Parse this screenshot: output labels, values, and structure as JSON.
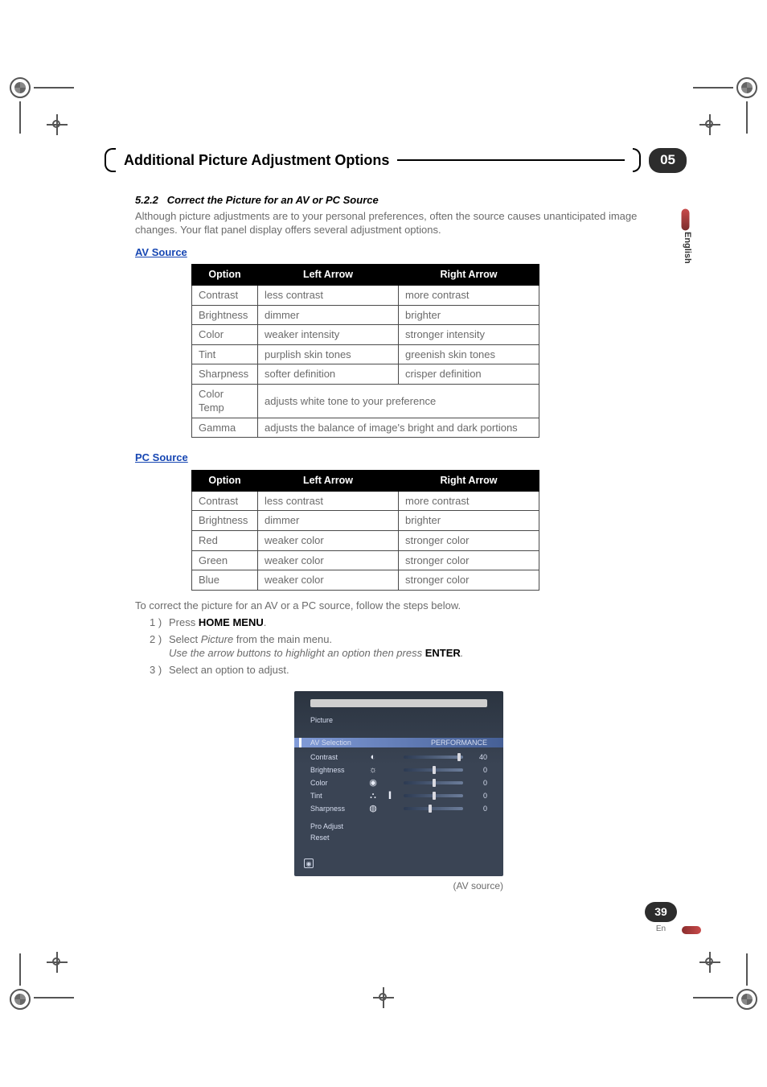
{
  "chapter": {
    "title": "Additional Picture Adjustment Options",
    "number": "05"
  },
  "side": {
    "lang": "English"
  },
  "section": {
    "number": "5.2.2",
    "title": "Correct the Picture for an AV or PC Source",
    "para": "Although picture adjustments are to your personal preferences, often the source causes unanticipated image changes. Your flat panel display offers several adjustment options."
  },
  "tables": {
    "av": {
      "label": "AV Source",
      "headers": {
        "opt": "Option",
        "left": "Left Arrow",
        "right": "Right Arrow"
      },
      "rows": [
        {
          "opt": "Contrast",
          "left": "less contrast",
          "right": "more contrast"
        },
        {
          "opt": "Brightness",
          "left": "dimmer",
          "right": "brighter"
        },
        {
          "opt": "Color",
          "left": "weaker intensity",
          "right": "stronger intensity"
        },
        {
          "opt": "Tint",
          "left": "purplish skin tones",
          "right": "greenish skin tones"
        },
        {
          "opt": "Sharpness",
          "left": "softer definition",
          "right": "crisper definition"
        },
        {
          "opt": "Color Temp",
          "span": "adjusts white tone to your preference"
        },
        {
          "opt": "Gamma",
          "span": "adjusts the balance of image's bright and dark portions"
        }
      ]
    },
    "pc": {
      "label": "PC Source",
      "headers": {
        "opt": "Option",
        "left": "Left Arrow",
        "right": "Right Arrow"
      },
      "rows": [
        {
          "opt": "Contrast",
          "left": "less contrast",
          "right": "more contrast"
        },
        {
          "opt": "Brightness",
          "left": "dimmer",
          "right": "brighter"
        },
        {
          "opt": "Red",
          "left": "weaker color",
          "right": "stronger color"
        },
        {
          "opt": "Green",
          "left": "weaker color",
          "right": "stronger color"
        },
        {
          "opt": "Blue",
          "left": "weaker color",
          "right": "stronger color"
        }
      ]
    }
  },
  "steps": {
    "intro": "To correct the picture for an AV or a PC source, follow the steps below.",
    "items": [
      {
        "pre": "Press ",
        "bold": "HOME MENU",
        "post": "."
      },
      {
        "pre": "Select ",
        "ital": "Picture",
        "mid": " from the main menu.",
        "sub_ital": "Use the arrow buttons to highlight an option then press ",
        "sub_bold": "ENTER",
        "sub_post": "."
      },
      {
        "pre": "Select an option to adjust."
      }
    ]
  },
  "osd": {
    "title": "Picture",
    "highlight": "AV Selection",
    "highlight_val": "PERFORMANCE",
    "rows": [
      {
        "label": "Contrast",
        "icon": "◐",
        "ind": "",
        "val": "40",
        "pos": 90
      },
      {
        "label": "Brightness",
        "icon": "☼",
        "ind": "",
        "val": "0",
        "pos": 48
      },
      {
        "label": "Color",
        "icon": "◉",
        "ind": "",
        "val": "0",
        "pos": 48
      },
      {
        "label": "Tint",
        "icon": "⛬",
        "ind": "▍",
        "val": "0",
        "pos": 48
      },
      {
        "label": "Sharpness",
        "icon": "◍",
        "ind": "",
        "val": "0",
        "pos": 42
      }
    ],
    "aux": [
      {
        "label": "Pro Adjust"
      },
      {
        "label": "Reset"
      }
    ],
    "corner": "◉",
    "caption": "(AV source)"
  },
  "page": {
    "number": "39",
    "lang": "En"
  }
}
